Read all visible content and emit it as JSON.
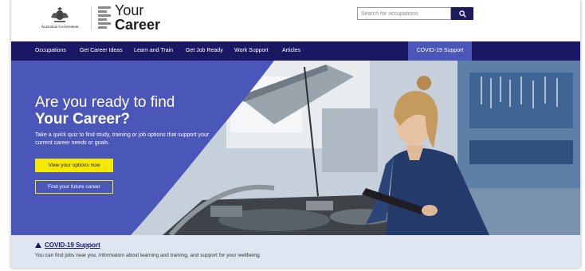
{
  "header": {
    "gov_logo_text": "Australian Government",
    "brand_line1": "Your",
    "brand_line2": "Career",
    "search": {
      "placeholder": "Search for occupations",
      "value": "",
      "button_icon": "search-icon"
    }
  },
  "nav": {
    "items": [
      {
        "label": "Occupations"
      },
      {
        "label": "Get Career Ideas"
      },
      {
        "label": "Learn and Train"
      },
      {
        "label": "Get Job Ready"
      },
      {
        "label": "Work Support"
      },
      {
        "label": "Articles"
      }
    ],
    "highlight": {
      "label": "COVID-19 Support"
    }
  },
  "hero": {
    "title_line1": "Are you ready to find",
    "title_line2": "Your Career?",
    "subtitle": "Take a quick quiz to find study, training or job options that support your current career needs or goals.",
    "primary_button": "View your options now",
    "secondary_button": "Find your future career"
  },
  "covid_banner": {
    "icon": "warning-triangle-icon",
    "link": "COVID-19 Support",
    "description": "You can find jobs near you, information about learning and training, and support for your wellbeing."
  },
  "colors": {
    "navy": "#1b1863",
    "hero_blue": "#4a56b8",
    "accent_yellow": "#f7e800",
    "banner_bg": "#dfe6f1"
  }
}
